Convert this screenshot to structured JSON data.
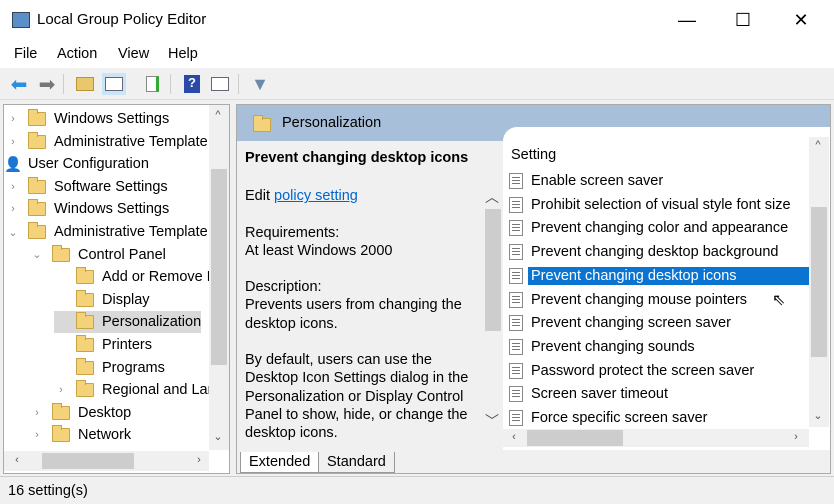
{
  "window": {
    "title": "Local Group Policy Editor",
    "minimize": "—",
    "maximize": "☐",
    "close": "✕"
  },
  "menu": [
    "File",
    "Action",
    "View",
    "Help"
  ],
  "toolbar": [
    "back-icon",
    "forward-icon",
    "up-folder-icon",
    "show-hide-console-tree-icon",
    "export-list-icon",
    "help-icon",
    "show-action-pane-icon",
    "filter-icon"
  ],
  "tree": [
    {
      "label": "Windows Settings",
      "chev": "›"
    },
    {
      "label": "Administrative Template",
      "chev": "›"
    },
    {
      "label": "User Configuration",
      "chev": ""
    },
    {
      "label": "Software Settings",
      "chev": "›"
    },
    {
      "label": "Windows Settings",
      "chev": "›"
    },
    {
      "label": "Administrative Template",
      "chev": "⌄"
    },
    {
      "label": "Control Panel",
      "chev": "⌄"
    },
    {
      "label": "Add or Remove P",
      "chev": ""
    },
    {
      "label": "Display",
      "chev": ""
    },
    {
      "label": "Personalization",
      "chev": ""
    },
    {
      "label": "Printers",
      "chev": ""
    },
    {
      "label": "Programs",
      "chev": ""
    },
    {
      "label": "Regional and Lar",
      "chev": "›"
    },
    {
      "label": "Desktop",
      "chev": "›"
    },
    {
      "label": "Network",
      "chev": "›"
    }
  ],
  "right": {
    "header": "Personalization",
    "desc_title": "Prevent changing desktop icons",
    "edit_prefix": "Edit ",
    "edit_link": "policy setting",
    "req_label": "Requirements:",
    "req_value": "At least Windows 2000",
    "desc_label": "Description:",
    "desc_text": "Prevents users from changing the desktop icons.",
    "desc_more": "By default, users can use the Desktop Icon Settings dialog in the Personalization or Display Control Panel to show, hide, or change the desktop icons.",
    "column": "Setting",
    "settings": [
      "Enable screen saver",
      "Prohibit selection of visual style font size",
      "Prevent changing color and appearance",
      "Prevent changing desktop background",
      "Prevent changing desktop icons",
      "Prevent changing mouse pointers",
      "Prevent changing screen saver",
      "Prevent changing sounds",
      "Password protect the screen saver",
      "Screen saver timeout",
      "Force specific screen saver"
    ],
    "selected_index": 4
  },
  "tabs": [
    "Extended",
    "Standard"
  ],
  "status": "16 setting(s)"
}
